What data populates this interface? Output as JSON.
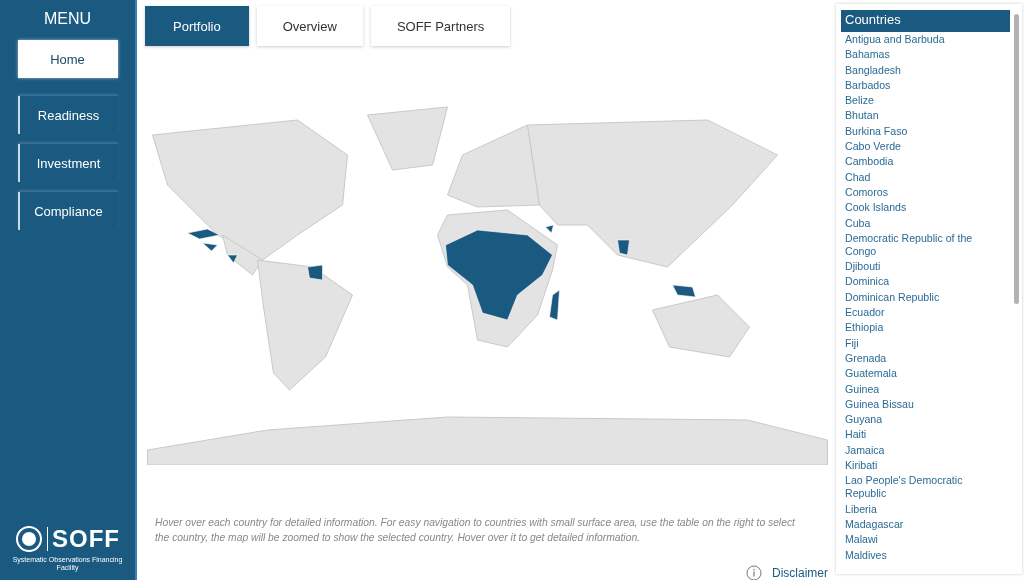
{
  "sidebar": {
    "title": "MENU",
    "items": [
      {
        "label": "Home",
        "selected": true
      },
      {
        "label": "Readiness",
        "selected": false
      },
      {
        "label": "Investment",
        "selected": false
      },
      {
        "label": "Compliance",
        "selected": false
      }
    ],
    "logo": {
      "text": "SOFF",
      "subtitle": "Systematic Observations Financing Facility"
    }
  },
  "tabs": [
    {
      "label": "Portfolio",
      "selected": true
    },
    {
      "label": "Overview",
      "selected": false
    },
    {
      "label": "SOFF Partners",
      "selected": false
    }
  ],
  "note": "Hover over each country for detailed information. For easy navigation to countries with small surface area, use the table on the right to select the country, the map will be zoomed to show the selected country. Hover over it to get detailed information.",
  "disclaimer": "Disclaimer",
  "countries": {
    "title": "Countries",
    "items": [
      "Antigua and Barbuda",
      "Bahamas",
      "Bangladesh",
      "Barbados",
      "Belize",
      "Bhutan",
      "Burkina Faso",
      "Cabo Verde",
      "Cambodia",
      "Chad",
      "Comoros",
      "Cook Islands",
      "Cuba",
      "Democratic Republic of the Congo",
      "Djibouti",
      "Dominica",
      "Dominican Republic",
      "Ecuador",
      "Ethiopia",
      "Fiji",
      "Grenada",
      "Guatemala",
      "Guinea",
      "Guinea Bissau",
      "Guyana",
      "Haiti",
      "Jamaica",
      "Kiribati",
      "Lao People's Democratic Republic",
      "Liberia",
      "Madagascar",
      "Malawi",
      "Maldives"
    ]
  }
}
